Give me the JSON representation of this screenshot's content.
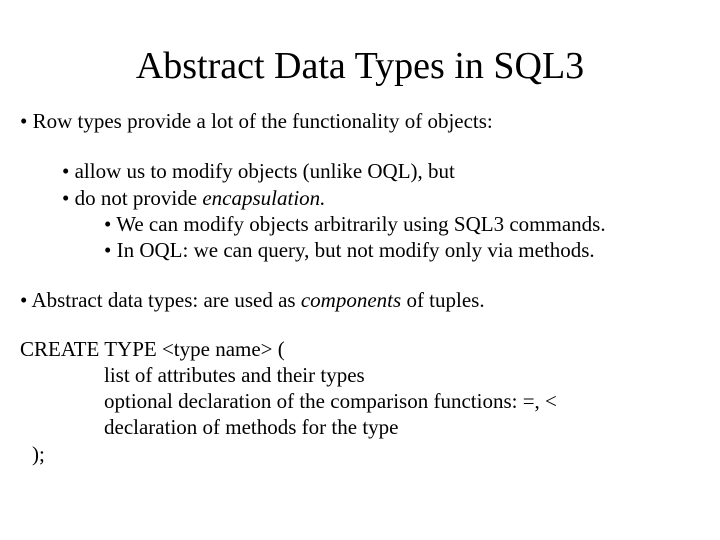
{
  "title": "Abstract Data Types in SQL3",
  "bullets": {
    "b1": "• Row types provide a lot of the functionality of objects:",
    "b2": "• allow us to modify objects (unlike OQL), but",
    "b3a": "• do not provide ",
    "b3b": "encapsulation.",
    "b4": "• We can modify objects arbitrarily using SQL3 commands.",
    "b5": "• In OQL: we can query, but not modify only via methods.",
    "b6a": "• Abstract data types:  are used as ",
    "b6b": "components",
    "b6c": " of tuples."
  },
  "code": {
    "l1": "CREATE TYPE   <type name> (",
    "l2": "list of attributes and their types",
    "l3": "optional declaration of the comparison functions: =, <",
    "l4": "declaration of methods for the  type",
    "l5": " );"
  }
}
